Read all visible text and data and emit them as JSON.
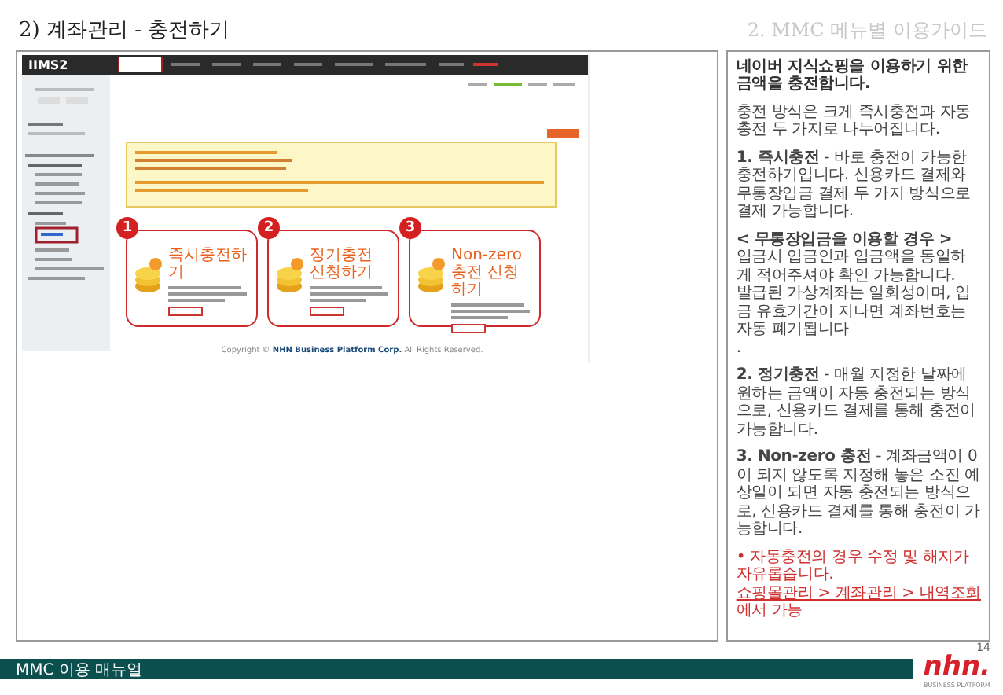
{
  "page_title": "2) 계좌관리 - 충전하기",
  "section_title": "2. MMC 메뉴별 이용가이드",
  "screenshot": {
    "logo": "IIMS2",
    "cards": [
      {
        "number": "1",
        "title": "즉시충전하기"
      },
      {
        "number": "2",
        "title": "정기충전 신청하기"
      },
      {
        "number": "3",
        "title": "Non-zero 충전 신청하기"
      }
    ],
    "copyright": "Copyright © **NHN Business Platform Corp.** All Rights Reserved."
  },
  "guide": [
    {
      "kind": "lead",
      "lines": [
        "네이버 지식쇼핑을 이용하기 위한 금액을 충전합니다."
      ]
    },
    {
      "kind": "text",
      "lines": [
        "충전 방식은 크게 즉시충전과 자동충전 두 가지로 나누어집니다."
      ]
    },
    {
      "kind": "text",
      "lines": [
        "**1. 즉시충전** - 바로 충전이 가능한 충전하기입니다. 신용카드 결제와 무통장입금 결제 두 가지 방식으로 결제 가능합니다."
      ]
    },
    {
      "kind": "text",
      "lines": [
        "**< 무통장입금을 이용할 경우 >**",
        "입금시 입금인과 입금액을 동일하게 적어주셔야 확인 가능합니다.",
        "발급된 가상계좌는 일회성이며, 입금 유효기간이 지나면 계좌번호는 자동 폐기됩니다",
        "."
      ]
    },
    {
      "kind": "text",
      "lines": [
        "**2. 정기충전** - 매월 지정한 날짜에 원하는 금액이 자동 충전되는 방식으로, 신용카드 결제를 통해 충전이 가능합니다."
      ]
    },
    {
      "kind": "text",
      "lines": [
        "**3. Non-zero 충전** - 계좌금액이 0이 되지 않도록 지정해 놓은 소진 예상일이 되면 자동 충전되는 방식으로, 신용카드 결제를 통해 충전이 가능합니다."
      ]
    },
    {
      "kind": "note",
      "lines": [
        "• 자동충전의 경우 수정 및 해지가 자유롭습니다."
      ],
      "link": "쇼핑몰관리 > 계좌관리 > 내역조회",
      "link_suffix": "에서 가능"
    }
  ],
  "footer": {
    "manual_title": "MMC 이용 매뉴얼",
    "page_number": "14",
    "brand": "nhn.",
    "brand_sub": "BUSINESS PLATFORM"
  }
}
